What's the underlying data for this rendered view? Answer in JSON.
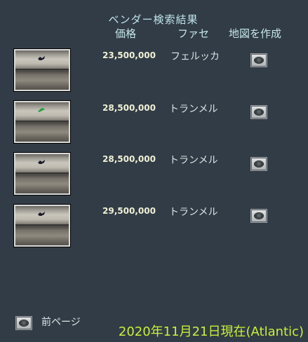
{
  "header": {
    "title": "ベンダー検索結果",
    "col_price": "価格",
    "col_town": "ファセ",
    "col_map": "地図を作成"
  },
  "results": [
    {
      "price": "23,500,000",
      "town": "フェルッカ",
      "mark_color": "#1a1a2a"
    },
    {
      "price": "28,500,000",
      "town": "トランメル",
      "mark_color": "#2aa040"
    },
    {
      "price": "28,500,000",
      "town": "トランメル",
      "mark_color": "#1a1a2a"
    },
    {
      "price": "29,500,000",
      "town": "トランメル",
      "mark_color": "#1a1a2a"
    }
  ],
  "footer": {
    "prev_page_label": "前ページ",
    "date_text": "2020年11月21日現在(Atlantic)"
  },
  "colors": {
    "background": "#323c46",
    "heading": "#bfe4ea",
    "price": "#f0f0d6",
    "date": "#c8f03a"
  }
}
